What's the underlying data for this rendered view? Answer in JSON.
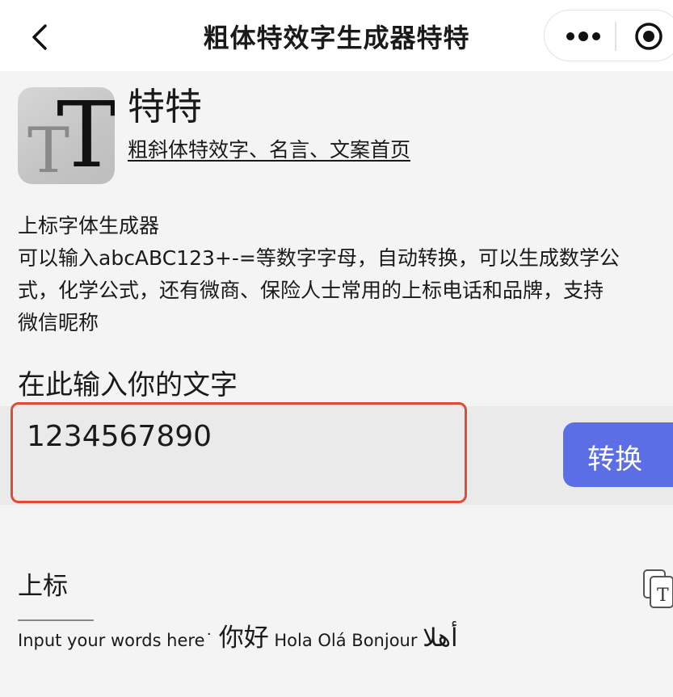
{
  "nav": {
    "title": "粗体特效字生成器特特"
  },
  "app": {
    "logo_text_large": "T",
    "logo_text_small": "T",
    "name": "特特",
    "link": "粗斜体特效字、名言、文案首页"
  },
  "description": {
    "heading": "上标字体生成器",
    "line1": "可以输入abcABC123+-=等数字字母，自动转换，可以生成数学公",
    "line2": "式，化学公式，还有微商、保险人士常用的上标电话和品牌，支持",
    "line3": "微信昵称"
  },
  "input": {
    "label": "在此输入你的文字",
    "value": "1234567890",
    "convert_label": "转换"
  },
  "result": {
    "label": "上标",
    "sample_en": "Input your words here",
    "sample_dot": "˙",
    "sample_zh": "你好",
    "sample_rest": " Hola Olá Bonjour ",
    "sample_ar": "أهلا"
  },
  "colors": {
    "highlight_border": "#e04a3a",
    "button": "#5b6ee6"
  },
  "icons": [
    "back-icon",
    "more-icon",
    "target-icon",
    "copy-icon"
  ]
}
